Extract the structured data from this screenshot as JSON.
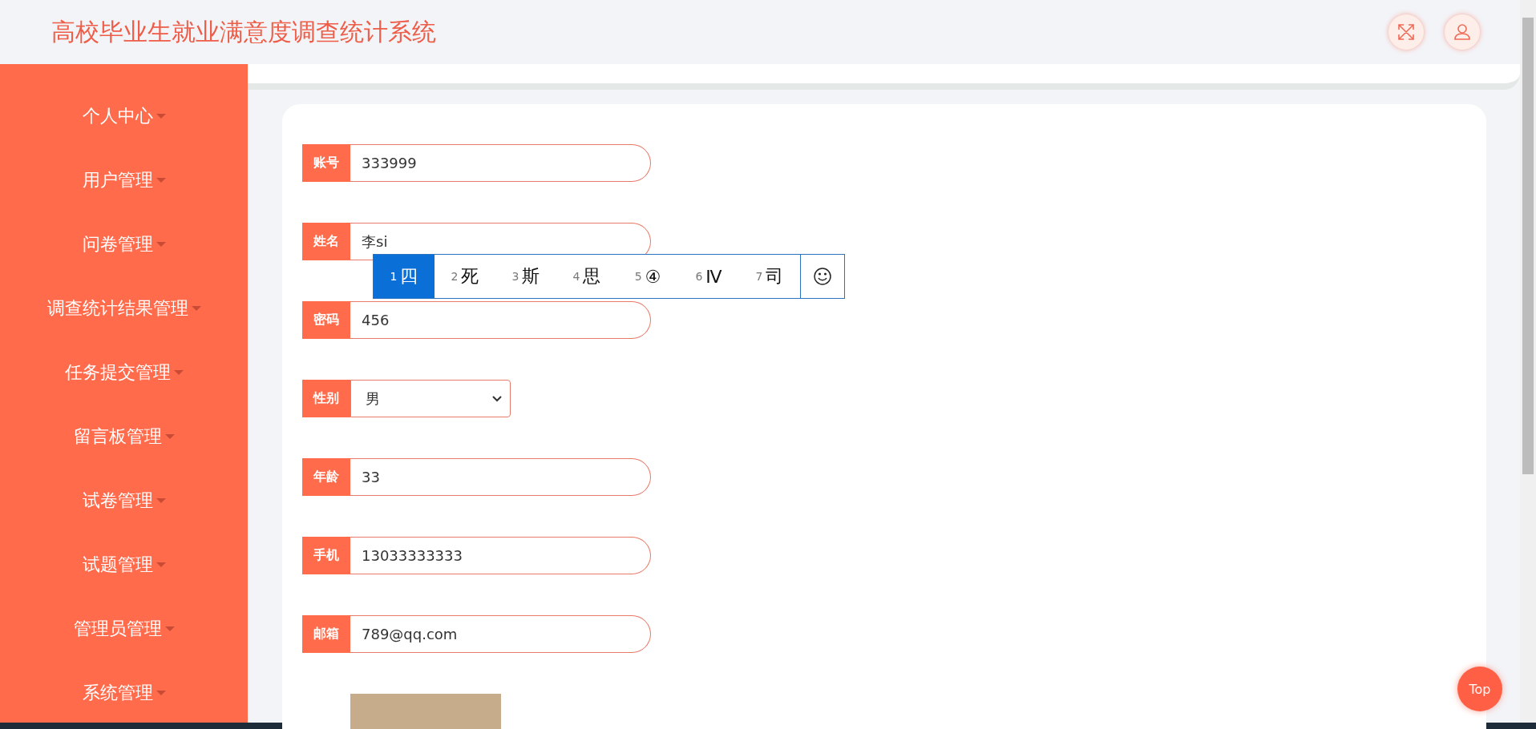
{
  "header": {
    "title": "高校毕业生就业满意度调查统计系统"
  },
  "sidebar": {
    "items": [
      {
        "label": "个人中心"
      },
      {
        "label": "用户管理"
      },
      {
        "label": "问卷管理"
      },
      {
        "label": "调查统计结果管理"
      },
      {
        "label": "任务提交管理"
      },
      {
        "label": "留言板管理"
      },
      {
        "label": "试卷管理"
      },
      {
        "label": "试题管理"
      },
      {
        "label": "管理员管理"
      },
      {
        "label": "系统管理"
      }
    ]
  },
  "form": {
    "fields": [
      {
        "label": "账号",
        "value": "333999",
        "kind": "input"
      },
      {
        "label": "姓名",
        "value": "李si",
        "kind": "input"
      },
      {
        "label": "密码",
        "value": "456",
        "kind": "input"
      },
      {
        "label": "性别",
        "value": "男",
        "kind": "select"
      },
      {
        "label": "年龄",
        "value": "33",
        "kind": "input"
      },
      {
        "label": "手机",
        "value": "13033333333",
        "kind": "input"
      },
      {
        "label": "邮箱",
        "value": "789@qq.com",
        "kind": "input"
      },
      {
        "kind": "image"
      }
    ]
  },
  "ime": {
    "candidates": [
      {
        "number": "1",
        "text": "四",
        "selected": true
      },
      {
        "number": "2",
        "text": "死",
        "selected": false
      },
      {
        "number": "3",
        "text": "斯",
        "selected": false
      },
      {
        "number": "4",
        "text": "思",
        "selected": false
      },
      {
        "number": "5",
        "text": "④",
        "selected": false
      },
      {
        "number": "6",
        "text": "Ⅳ",
        "selected": false
      },
      {
        "number": "7",
        "text": "司",
        "selected": false
      }
    ]
  },
  "top_button": "Top"
}
